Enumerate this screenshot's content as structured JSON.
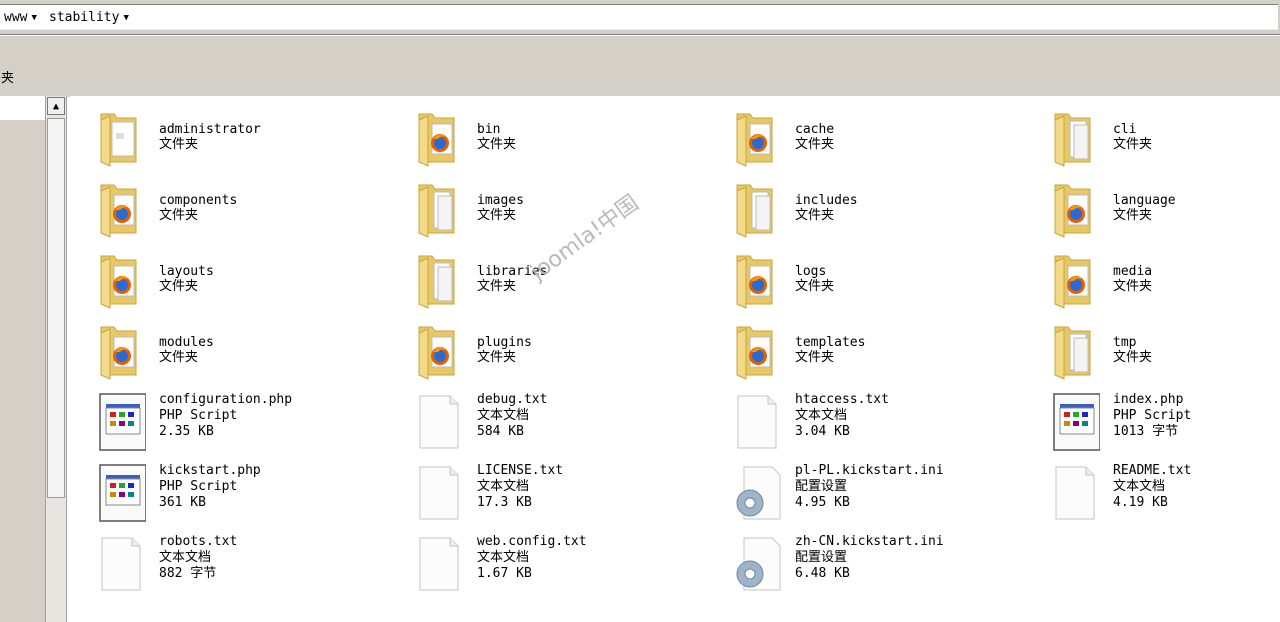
{
  "breadcrumb": {
    "items": [
      {
        "label": "www"
      },
      {
        "label": "stability"
      }
    ]
  },
  "toolbar": {
    "partial_label": "夹"
  },
  "watermark": "joomla!中国",
  "items": [
    {
      "name": "administrator",
      "type": "文件夹",
      "size": "",
      "kind": "folder",
      "icon": "folder-doc-icon"
    },
    {
      "name": "bin",
      "type": "文件夹",
      "size": "",
      "kind": "folder",
      "icon": "folder-firefox-icon"
    },
    {
      "name": "cache",
      "type": "文件夹",
      "size": "",
      "kind": "folder",
      "icon": "folder-firefox-icon"
    },
    {
      "name": "cli",
      "type": "文件夹",
      "size": "",
      "kind": "folder",
      "icon": "folder-docs-icon"
    },
    {
      "name": "components",
      "type": "文件夹",
      "size": "",
      "kind": "folder",
      "icon": "folder-firefox-icon"
    },
    {
      "name": "images",
      "type": "文件夹",
      "size": "",
      "kind": "folder",
      "icon": "folder-docs-icon"
    },
    {
      "name": "includes",
      "type": "文件夹",
      "size": "",
      "kind": "folder",
      "icon": "folder-docs-icon"
    },
    {
      "name": "language",
      "type": "文件夹",
      "size": "",
      "kind": "folder",
      "icon": "folder-firefox-icon"
    },
    {
      "name": "layouts",
      "type": "文件夹",
      "size": "",
      "kind": "folder",
      "icon": "folder-firefox-icon"
    },
    {
      "name": "libraries",
      "type": "文件夹",
      "size": "",
      "kind": "folder",
      "icon": "folder-docs-icon"
    },
    {
      "name": "logs",
      "type": "文件夹",
      "size": "",
      "kind": "folder",
      "icon": "folder-firefox-icon"
    },
    {
      "name": "media",
      "type": "文件夹",
      "size": "",
      "kind": "folder",
      "icon": "folder-firefox-icon"
    },
    {
      "name": "modules",
      "type": "文件夹",
      "size": "",
      "kind": "folder",
      "icon": "folder-firefox-icon"
    },
    {
      "name": "plugins",
      "type": "文件夹",
      "size": "",
      "kind": "folder",
      "icon": "folder-firefox-icon"
    },
    {
      "name": "templates",
      "type": "文件夹",
      "size": "",
      "kind": "folder",
      "icon": "folder-firefox-icon"
    },
    {
      "name": "tmp",
      "type": "文件夹",
      "size": "",
      "kind": "folder",
      "icon": "folder-docs-icon"
    },
    {
      "name": "configuration.php",
      "type": "PHP Script",
      "size": "2.35 KB",
      "kind": "php",
      "icon": "php-script-icon"
    },
    {
      "name": "debug.txt",
      "type": "文本文档",
      "size": "584 KB",
      "kind": "txt",
      "icon": "text-document-icon"
    },
    {
      "name": "htaccess.txt",
      "type": "文本文档",
      "size": "3.04 KB",
      "kind": "txt",
      "icon": "text-document-icon"
    },
    {
      "name": "index.php",
      "type": "PHP Script",
      "size": "1013 字节",
      "kind": "php",
      "icon": "php-script-icon"
    },
    {
      "name": "kickstart.php",
      "type": "PHP Script",
      "size": "361 KB",
      "kind": "php",
      "icon": "php-script-icon"
    },
    {
      "name": "LICENSE.txt",
      "type": "文本文档",
      "size": "17.3 KB",
      "kind": "txt",
      "icon": "text-document-icon"
    },
    {
      "name": "pl-PL.kickstart.ini",
      "type": "配置设置",
      "size": "4.95 KB",
      "kind": "ini",
      "icon": "config-settings-icon"
    },
    {
      "name": "README.txt",
      "type": "文本文档",
      "size": "4.19 KB",
      "kind": "txt",
      "icon": "text-document-icon"
    },
    {
      "name": "robots.txt",
      "type": "文本文档",
      "size": "882 字节",
      "kind": "txt",
      "icon": "text-document-icon"
    },
    {
      "name": "web.config.txt",
      "type": "文本文档",
      "size": "1.67 KB",
      "kind": "txt",
      "icon": "text-document-icon"
    },
    {
      "name": "zh-CN.kickstart.ini",
      "type": "配置设置",
      "size": "6.48 KB",
      "kind": "ini",
      "icon": "config-settings-icon"
    }
  ]
}
